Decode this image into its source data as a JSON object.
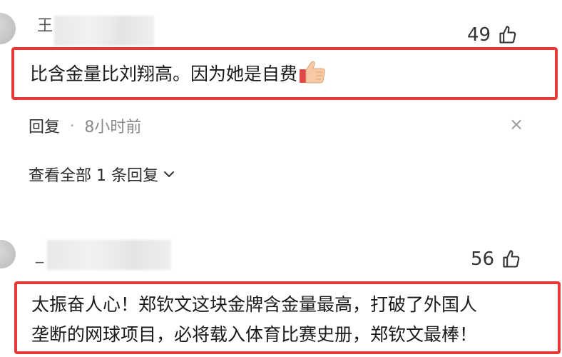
{
  "comments": [
    {
      "username_visible": "王",
      "likes": "49",
      "text": "比含金量比刘翔高。因为她是自费",
      "reply_label": "回复",
      "separator": "·",
      "time": "8小时前",
      "close_symbol": "×",
      "view_all": "查看全部 1 条回复"
    },
    {
      "username_visible": "_",
      "likes": "56",
      "text_line1": "太振奋人心！郑钦文这块金牌含金量最高，打破了外国人",
      "text_line2": "垄断的网球项目，必将载入体育比赛史册，郑钦文最棒！"
    }
  ],
  "icons": {
    "like": "thumbs-up-outline-icon",
    "emoji": "thumbs-up-emoji-icon",
    "chevron": "chevron-down-icon"
  },
  "colors": {
    "highlight_border": "#e53935"
  }
}
